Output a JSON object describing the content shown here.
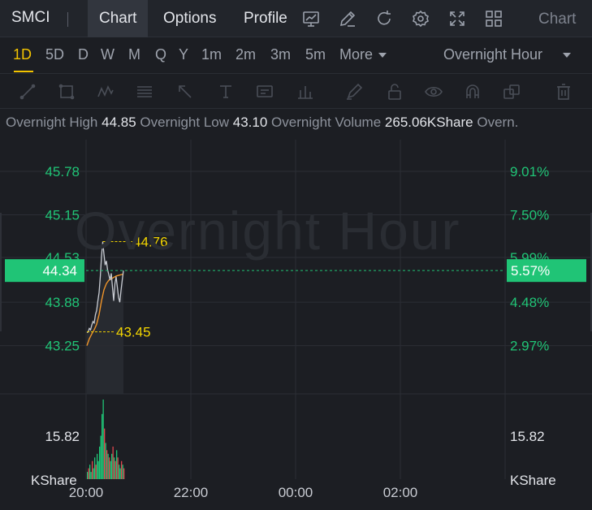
{
  "ticker": "SMCI",
  "tabs": [
    {
      "label": "Chart",
      "active": true
    },
    {
      "label": "Options",
      "active": false
    },
    {
      "label": "Profile",
      "active": false
    }
  ],
  "toolbar_icons": [
    "line-chart-icon",
    "pencil-icon",
    "refresh-icon",
    "gear-icon",
    "fullscreen-icon",
    "grid-icon"
  ],
  "toolbar_right_label": "Chart",
  "periods": [
    "1D",
    "5D",
    "D",
    "W",
    "M",
    "Q",
    "Y",
    "1m",
    "2m",
    "3m",
    "5m"
  ],
  "active_period": "1D",
  "more_label": "More",
  "session": "Overnight Hour",
  "drawing_tools": [
    "trend-line-icon",
    "rectangle-icon",
    "wave-icon",
    "fib-icon",
    "arrow-icon",
    "text-icon",
    "note-icon",
    "position-icon",
    "brush-icon",
    "lock-icon",
    "eye-icon",
    "magnet-icon",
    "layers-icon",
    "trash-icon"
  ],
  "stats": {
    "high_label": "Overnight High",
    "high": "44.85",
    "low_label": "Overnight Low",
    "low": "43.10",
    "volume_label": "Overnight Volume",
    "volume": "265.06KShare",
    "truncated": "Overn."
  },
  "colors": {
    "up": "#20c476",
    "price_line": "#c8cbd2",
    "avg_line": "#f0952a",
    "annotation": "#f2d400",
    "volume_up": "#20c476",
    "volume_down": "#e0464e"
  },
  "watermark": "Overnight Hour",
  "chart_data": {
    "type": "line",
    "x_ticks": [
      "20:00",
      "22:00",
      "00:00",
      "02:00"
    ],
    "y_ticks": [
      "45.78",
      "45.15",
      "44.53",
      "43.88",
      "43.25"
    ],
    "y_pct_ticks": [
      "9.01%",
      "7.50%",
      "5.99%",
      "4.48%",
      "2.97%"
    ],
    "ylim": [
      42.55,
      46.24
    ],
    "current_price": "44.34",
    "current_pct": "5.57%",
    "high_annotation": "44.76",
    "low_annotation": "43.45",
    "volume_tick": "15.82",
    "volume_unit": "KShare",
    "price_series": [
      [
        0,
        43.44
      ],
      [
        1,
        43.45
      ],
      [
        2,
        43.5
      ],
      [
        3,
        43.48
      ],
      [
        4,
        43.55
      ],
      [
        5,
        43.6
      ],
      [
        6,
        43.58
      ],
      [
        7,
        43.7
      ],
      [
        8,
        43.76
      ],
      [
        9,
        43.9
      ],
      [
        10,
        44.02
      ],
      [
        11,
        44.25
      ],
      [
        12,
        44.55
      ],
      [
        13,
        44.76
      ],
      [
        14,
        44.58
      ],
      [
        15,
        44.42
      ],
      [
        16,
        44.48
      ],
      [
        17,
        44.35
      ],
      [
        18,
        44.28
      ],
      [
        19,
        44.2
      ],
      [
        20,
        44.3
      ],
      [
        21,
        44.1
      ],
      [
        22,
        43.9
      ],
      [
        23,
        44.15
      ],
      [
        24,
        44.25
      ],
      [
        25,
        44.1
      ],
      [
        26,
        43.95
      ],
      [
        27,
        43.88
      ],
      [
        28,
        44.05
      ],
      [
        29,
        44.2
      ],
      [
        30,
        44.34
      ]
    ],
    "avg_series": [
      [
        0,
        43.25
      ],
      [
        2,
        43.35
      ],
      [
        4,
        43.42
      ],
      [
        6,
        43.48
      ],
      [
        8,
        43.56
      ],
      [
        10,
        43.7
      ],
      [
        12,
        43.9
      ],
      [
        14,
        44.06
      ],
      [
        16,
        44.15
      ],
      [
        18,
        44.2
      ],
      [
        20,
        44.22
      ],
      [
        22,
        44.24
      ],
      [
        24,
        44.26
      ],
      [
        26,
        44.27
      ],
      [
        28,
        44.28
      ],
      [
        30,
        44.29
      ]
    ],
    "volume": [
      [
        0,
        2,
        "up"
      ],
      [
        1,
        3,
        "down"
      ],
      [
        2,
        4,
        "up"
      ],
      [
        3,
        2,
        "up"
      ],
      [
        4,
        5,
        "down"
      ],
      [
        5,
        3,
        "up"
      ],
      [
        6,
        6,
        "up"
      ],
      [
        7,
        4,
        "down"
      ],
      [
        8,
        7,
        "up"
      ],
      [
        9,
        5,
        "up"
      ],
      [
        10,
        9,
        "up"
      ],
      [
        11,
        12,
        "up"
      ],
      [
        12,
        18,
        "up"
      ],
      [
        13,
        22,
        "up"
      ],
      [
        14,
        14,
        "down"
      ],
      [
        15,
        10,
        "up"
      ],
      [
        16,
        8,
        "down"
      ],
      [
        17,
        7,
        "up"
      ],
      [
        18,
        6,
        "down"
      ],
      [
        19,
        5,
        "up"
      ],
      [
        20,
        7,
        "up"
      ],
      [
        21,
        9,
        "down"
      ],
      [
        22,
        6,
        "up"
      ],
      [
        23,
        5,
        "down"
      ],
      [
        24,
        8,
        "up"
      ],
      [
        25,
        6,
        "down"
      ],
      [
        26,
        4,
        "up"
      ],
      [
        27,
        3,
        "up"
      ],
      [
        28,
        5,
        "down"
      ],
      [
        29,
        4,
        "up"
      ],
      [
        30,
        3,
        "down"
      ]
    ]
  }
}
